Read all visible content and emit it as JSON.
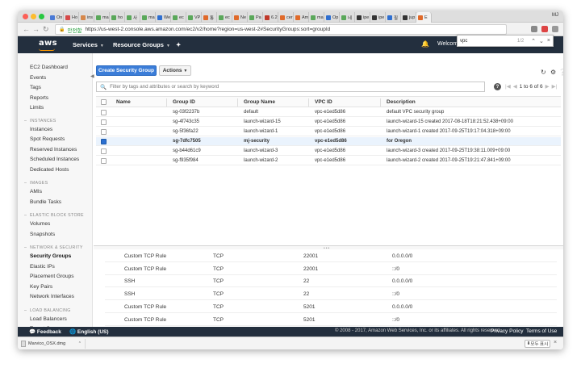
{
  "browser": {
    "tabs": [
      {
        "label": "On",
        "color": "#4a7ad6"
      },
      {
        "label": "Ho",
        "color": "#d64a4a"
      },
      {
        "label": "ins",
        "color": "#d6874a"
      },
      {
        "label": "ma",
        "color": "#5aa85a"
      },
      {
        "label": "ho",
        "color": "#5aa85a"
      },
      {
        "label": "사",
        "color": "#5aa85a"
      },
      {
        "label": "ma",
        "color": "#5aa85a"
      },
      {
        "label": "We",
        "color": "#2f6fd0"
      },
      {
        "label": "ec",
        "color": "#5aa85a"
      },
      {
        "label": "VP",
        "color": "#5aa85a"
      },
      {
        "label": "통",
        "color": "#e06a2a"
      },
      {
        "label": "ec",
        "color": "#5aa85a"
      },
      {
        "label": "Ne",
        "color": "#e06a2a"
      },
      {
        "label": "Pa",
        "color": "#5aa85a"
      },
      {
        "label": "6.2",
        "color": "#c0392b"
      },
      {
        "label": "cer",
        "color": "#e06a2a"
      },
      {
        "label": "Am",
        "color": "#e06a2a"
      },
      {
        "label": "ma",
        "color": "#5aa85a"
      },
      {
        "label": "Op",
        "color": "#2f6fd0"
      },
      {
        "label": "네",
        "color": "#5aa85a"
      },
      {
        "label": "ipe",
        "color": "#333333"
      },
      {
        "label": "ipe",
        "color": "#333333"
      },
      {
        "label": "필",
        "color": "#2f6fd0"
      },
      {
        "label": "jup",
        "color": "#333333"
      },
      {
        "label": "E",
        "color": "#e06a2a"
      }
    ],
    "profile": "MJ",
    "secure_label": "안전함",
    "url": "https://us-west-2.console.aws.amazon.com/ec2/v2/home?region=us-west-2#SecurityGroups:sort=groupId",
    "find": {
      "query": "vpc",
      "count": "1/2"
    }
  },
  "awsnav": {
    "logo": "aws",
    "services": "Services",
    "resource_groups": "Resource Groups",
    "welcome": "Welcome"
  },
  "sidebar": {
    "top_items": [
      "EC2 Dashboard",
      "Events",
      "Tags",
      "Reports",
      "Limits"
    ],
    "sections": [
      {
        "title": "INSTANCES",
        "items": [
          "Instances",
          "Spot Requests",
          "Reserved Instances",
          "Scheduled Instances",
          "Dedicated Hosts"
        ]
      },
      {
        "title": "IMAGES",
        "items": [
          "AMIs",
          "Bundle Tasks"
        ]
      },
      {
        "title": "ELASTIC BLOCK STORE",
        "items": [
          "Volumes",
          "Snapshots"
        ]
      },
      {
        "title": "NETWORK & SECURITY",
        "items": [
          "Security Groups",
          "Elastic IPs",
          "Placement Groups",
          "Key Pairs",
          "Network Interfaces"
        ]
      },
      {
        "title": "LOAD BALANCING",
        "items": [
          "Load Balancers",
          "Target Groups"
        ]
      }
    ],
    "active_item": "Security Groups"
  },
  "toolbar": {
    "create_label": "Create Security Group",
    "actions_label": "Actions",
    "filter_placeholder": "Filter by tags and attributes or search by keyword",
    "pager_text": "1 to 6 of 6"
  },
  "table": {
    "headers": [
      "Name",
      "Group ID",
      "Group Name",
      "VPC ID",
      "Description"
    ],
    "rows": [
      {
        "name": "",
        "group_id": "sg-03f2237b",
        "group_name": "default",
        "vpc_id": "vpc-e1ed5d86",
        "description": "default VPC security group",
        "selected": false
      },
      {
        "name": "",
        "group_id": "sg-4f743c35",
        "group_name": "launch-wizard-15",
        "vpc_id": "vpc-e1ed5d86",
        "description": "launch-wizard-15 created 2017-08-18T18:21:52.438+09:00",
        "selected": false
      },
      {
        "name": "",
        "group_id": "sg-5f36fa22",
        "group_name": "launch-wizard-1",
        "vpc_id": "vpc-e1ed5d86",
        "description": "launch-wizard-1 created 2017-09-25T19:17:04.318+09:00",
        "selected": false
      },
      {
        "name": "",
        "group_id": "sg-7dfc7505",
        "group_name": "mj-security",
        "vpc_id": "vpc-e1ed5d86",
        "description": "for Oregon",
        "selected": true
      },
      {
        "name": "",
        "group_id": "sg-b44d61c9",
        "group_name": "launch-wizard-3",
        "vpc_id": "vpc-e1ed5d86",
        "description": "launch-wizard-3 created 2017-09-25T19:38:11.009+09:00",
        "selected": false
      },
      {
        "name": "",
        "group_id": "sg-f935f984",
        "group_name": "launch-wizard-2",
        "vpc_id": "vpc-e1ed5d86",
        "description": "launch-wizard-2 created 2017-09-25T19:21:47.841+09:00",
        "selected": false
      }
    ]
  },
  "rules": [
    {
      "type": "Custom TCP Rule",
      "protocol": "TCP",
      "port": "22001",
      "source": "0.0.0.0/0"
    },
    {
      "type": "Custom TCP Rule",
      "protocol": "TCP",
      "port": "22001",
      "source": "::/0"
    },
    {
      "type": "SSH",
      "protocol": "TCP",
      "port": "22",
      "source": "0.0.0.0/0"
    },
    {
      "type": "SSH",
      "protocol": "TCP",
      "port": "22",
      "source": "::/0"
    },
    {
      "type": "Custom TCP Rule",
      "protocol": "TCP",
      "port": "5201",
      "source": "0.0.0.0/0"
    },
    {
      "type": "Custom TCP Rule",
      "protocol": "TCP",
      "port": "5201",
      "source": "::/0"
    }
  ],
  "footer": {
    "feedback": "Feedback",
    "language": "English (US)",
    "copyright": "© 2008 - 2017, Amazon Web Services, Inc. or its affiliates. All rights reserved.",
    "privacy": "Privacy Policy",
    "terms": "Terms of Use"
  },
  "downloads": {
    "file": "Marvico_OSX.dmg",
    "show_all": "모두 표시"
  },
  "colors": {
    "aws_nav": "#232f3e",
    "primary_button": "#3b7dd8",
    "selected_row": "#eaf3fd"
  }
}
